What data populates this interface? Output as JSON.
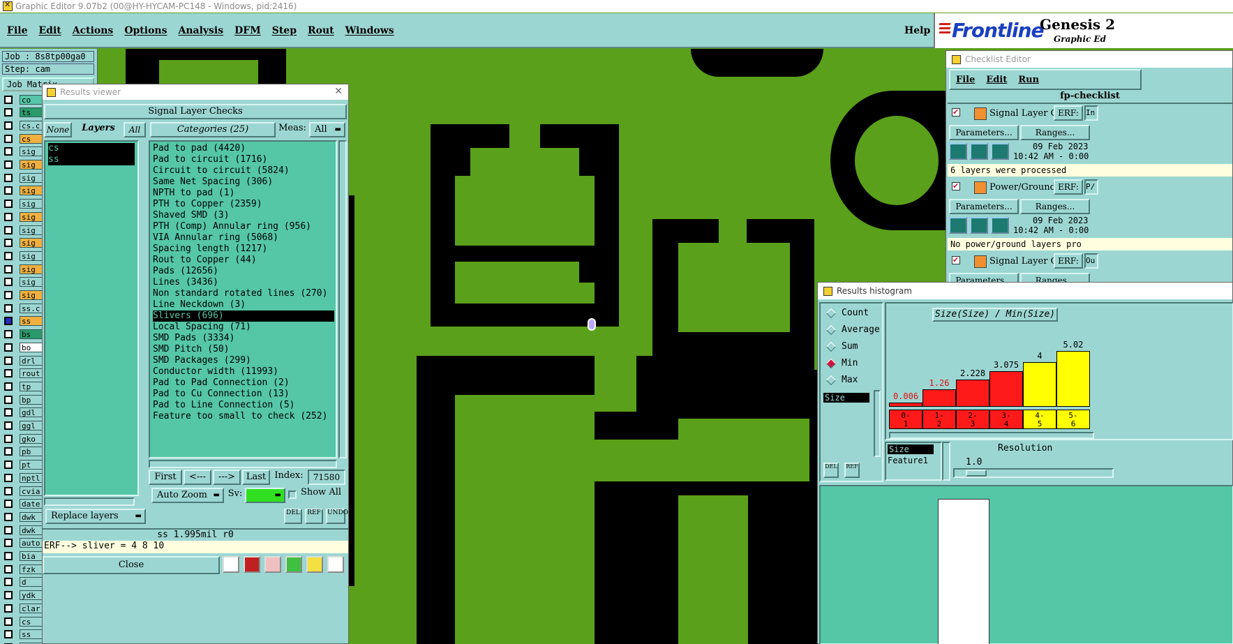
{
  "window": {
    "title": "Graphic Editor 9.07b2 (00@HY-HYCAM-PC148 - Windows, pid:2416)"
  },
  "menubar": {
    "items": [
      "File",
      "Edit",
      "Actions",
      "Options",
      "Analysis",
      "DFM",
      "Step",
      "Rout",
      "Windows"
    ],
    "help": "Help"
  },
  "logo": {
    "brand": "Frontline",
    "product": "Genesis 2",
    "subtitle": "Graphic Ed"
  },
  "job_panel": {
    "job": "Job : 8s8tp00ga0",
    "step": "Step: cam",
    "job_matrix": "Job Matrix",
    "layers": [
      {
        "name": "co",
        "color": "#55c6a6",
        "checked": false
      },
      {
        "name": "ts",
        "color": "#2a9a6a",
        "checked": false
      },
      {
        "name": "cs.c",
        "color": "#9cd6d2",
        "checked": false
      },
      {
        "name": "cs",
        "color": "#f0b040",
        "checked": false
      },
      {
        "name": "sig",
        "color": "#9cd6d2",
        "checked": false
      },
      {
        "name": "sig",
        "color": "#f0b040",
        "checked": false
      },
      {
        "name": "sig",
        "color": "#9cd6d2",
        "checked": false
      },
      {
        "name": "sig",
        "color": "#f0b040",
        "checked": false
      },
      {
        "name": "sig",
        "color": "#9cd6d2",
        "checked": false
      },
      {
        "name": "sig",
        "color": "#f0b040",
        "checked": false
      },
      {
        "name": "sig",
        "color": "#9cd6d2",
        "checked": false
      },
      {
        "name": "sig",
        "color": "#f0b040",
        "checked": false
      },
      {
        "name": "sig",
        "color": "#9cd6d2",
        "checked": false
      },
      {
        "name": "sig",
        "color": "#f0b040",
        "checked": false
      },
      {
        "name": "sig",
        "color": "#9cd6d2",
        "checked": false
      },
      {
        "name": "sig",
        "color": "#f0b040",
        "checked": false
      },
      {
        "name": "ss.c",
        "color": "#9cd6d2",
        "checked": false
      },
      {
        "name": "ss",
        "color": "#f0b040",
        "checked": true
      },
      {
        "name": "bs",
        "color": "#2a9a6a",
        "checked": false
      },
      {
        "name": "bo",
        "color": "#ffffff",
        "checked": false
      },
      {
        "name": "drl",
        "color": "#9cd6d2",
        "checked": false
      },
      {
        "name": "rout",
        "color": "#9cd6d2",
        "checked": false
      },
      {
        "name": "tp",
        "color": "#9cd6d2",
        "checked": false
      },
      {
        "name": "bp",
        "color": "#9cd6d2",
        "checked": false
      },
      {
        "name": "gdl",
        "color": "#9cd6d2",
        "checked": false
      },
      {
        "name": "ggl",
        "color": "#9cd6d2",
        "checked": false
      },
      {
        "name": "gko",
        "color": "#9cd6d2",
        "checked": false
      },
      {
        "name": "pb",
        "color": "#9cd6d2",
        "checked": false
      },
      {
        "name": "pt",
        "color": "#9cd6d2",
        "checked": false
      },
      {
        "name": "nptl",
        "color": "#9cd6d2",
        "checked": false
      },
      {
        "name": "cvia",
        "color": "#9cd6d2",
        "checked": false
      },
      {
        "name": "date",
        "color": "#9cd6d2",
        "checked": false
      },
      {
        "name": "dwk",
        "color": "#9cd6d2",
        "checked": false
      },
      {
        "name": "dwk",
        "color": "#9cd6d2",
        "checked": false
      },
      {
        "name": "auto",
        "color": "#9cd6d2",
        "checked": false
      },
      {
        "name": "bia",
        "color": "#9cd6d2",
        "checked": false
      },
      {
        "name": "fzk",
        "color": "#9cd6d2",
        "checked": false
      },
      {
        "name": "d",
        "color": "#9cd6d2",
        "checked": false
      },
      {
        "name": "ydk",
        "color": "#9cd6d2",
        "checked": false
      },
      {
        "name": "clar",
        "color": "#9cd6d2",
        "checked": false
      },
      {
        "name": "cs_",
        "color": "#9cd6d2",
        "checked": false
      },
      {
        "name": "ss_",
        "color": "#9cd6d2",
        "checked": false
      },
      {
        "name": "via",
        "color": "#9cd6d2",
        "checked": false
      }
    ]
  },
  "results_viewer": {
    "title": "Results viewer",
    "header": "Signal Layer Checks",
    "none": "None",
    "layers": "Layers",
    "all": "All",
    "categories_label": "Categories (25)",
    "meas_label": "Meas:",
    "meas_value": "All",
    "layer_list": [
      "cs",
      "ss"
    ],
    "categories": [
      "Pad to pad (4420)",
      "Pad to circuit (1716)",
      "Circuit to circuit (5824)",
      "Same Net Spacing (306)",
      "NPTH to pad (1)",
      "PTH to Copper (2359)",
      "Shaved SMD (3)",
      "PTH (Comp) Annular ring (956)",
      "VIA Annular ring (5068)",
      "Spacing length (1217)",
      "Rout to Copper (44)",
      "Pads (12656)",
      "Lines (3436)",
      "Non standard rotated lines (270)",
      "Line Neckdown (3)",
      "Slivers (696)",
      "Local Spacing (71)",
      "SMD Pads (3334)",
      "SMD Pitch (50)",
      "SMD Packages (299)",
      "Conductor width (11993)",
      "Pad to Pad Connection (2)",
      "Pad to Cu Connection (13)",
      "Pad to Line Connection (5)",
      "Feature too small to check (252)"
    ],
    "selected_category_index": 15,
    "first": "First",
    "prev": "<---",
    "next": "--->",
    "last": "Last",
    "index_label": "Index:",
    "index_value": "71580",
    "auto_zoom": "Auto Zoom",
    "sv_label": "Sv:",
    "show_all": "Show All",
    "replace_layers": "Replace layers",
    "del": "DEL",
    "ref": "REF",
    "undo": "UNDO",
    "measure_line": "ss 1.995mil  r0",
    "erf_line": "ERF--> sliver = 4 8 10",
    "close": "Close"
  },
  "checklist": {
    "title": "Checklist Editor",
    "menu": [
      "File",
      "Edit",
      "Run"
    ],
    "name": "fp-checklist",
    "items": [
      {
        "label": "Signal Layer Ch",
        "erf": "ERF:",
        "erf_value": "In",
        "parameters": "Parameters...",
        "ranges": "Ranges...",
        "date": "09 Feb 2023",
        "time": "10:42 AM - 0:00",
        "message": "6 layers were processed"
      },
      {
        "label": "Power/Ground C",
        "erf": "ERF:",
        "erf_value": "P/",
        "parameters": "Parameters...",
        "ranges": "Ranges...",
        "date": "09 Feb 2023",
        "time": "10:42 AM - 0:00",
        "message": "No power/ground layers pro"
      },
      {
        "label": "Signal Layer Ch",
        "erf": "ERF:",
        "erf_value": "Ou",
        "parameters": "Parameters...",
        "ranges": "Ranges..."
      }
    ]
  },
  "histogram": {
    "title": "Results histogram",
    "modes": [
      "Count",
      "Average",
      "Sum",
      "Min",
      "Max"
    ],
    "selected_mode": "Min",
    "chart_title": "Size(Size) / Min(Size)",
    "list_item": "Size",
    "bins": [
      "0-\n1",
      "1-\n2",
      "2-\n3",
      "3-\n4",
      "4-\n5",
      "5-\n6"
    ],
    "values": [
      "0.006",
      "1.26",
      "2.228",
      "3.075",
      "4",
      "5.02"
    ],
    "bar_levels": [
      0.0,
      0.25,
      0.44,
      0.61,
      0.79,
      1.0
    ],
    "bar_colors": [
      "#ff1a1a",
      "#ff1a1a",
      "#ff1a1a",
      "#ff1a1a",
      "#ffff00",
      "#ffff00"
    ],
    "size_label": "Size",
    "feature_label": "Feature1",
    "resolution_label": "Resolution",
    "resolution_value": "1.0",
    "del": "DEL",
    "ref": "REF"
  }
}
